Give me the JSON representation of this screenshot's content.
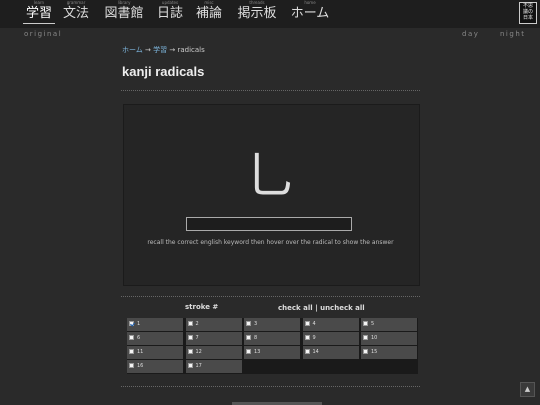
{
  "nav": {
    "items": [
      {
        "small": "learn",
        "label": "学習",
        "active": true
      },
      {
        "small": "grammar",
        "label": "文法"
      },
      {
        "small": "library",
        "label": "図書館"
      },
      {
        "small": "updates",
        "label": "日誌"
      },
      {
        "small": "misc",
        "label": "補論"
      },
      {
        "small": "threads",
        "label": "掲示板"
      },
      {
        "small": "home",
        "label": "ホーム"
      }
    ],
    "logo": [
      "不思",
      "議の",
      "日本"
    ]
  },
  "subbar": {
    "original": "original",
    "day": "day",
    "night": "night"
  },
  "breadcrumb": {
    "home": "ホーム",
    "arrow1": " → ",
    "study": "学習",
    "arrow2": " → ",
    "current": "radicals"
  },
  "page_title": "kanji radicals",
  "flashcard": {
    "radical": "乚",
    "input_value": "",
    "hint": "recall the correct english keyword then hover over the radical to show the answer"
  },
  "filters": {
    "stroke_label": "stroke #",
    "check_all": "check all",
    "separator": " | ",
    "uncheck_all": "uncheck all",
    "strokes": [
      {
        "n": "1",
        "checked": true
      },
      {
        "n": "2"
      },
      {
        "n": "3"
      },
      {
        "n": "4"
      },
      {
        "n": "5"
      },
      {
        "n": "6"
      },
      {
        "n": "7"
      },
      {
        "n": "8"
      },
      {
        "n": "9"
      },
      {
        "n": "10"
      },
      {
        "n": "11"
      },
      {
        "n": "12"
      },
      {
        "n": "13"
      },
      {
        "n": "14"
      },
      {
        "n": "15"
      },
      {
        "n": "16"
      },
      {
        "n": "17"
      }
    ]
  },
  "scroll_top_icon": "arrow-up-icon"
}
